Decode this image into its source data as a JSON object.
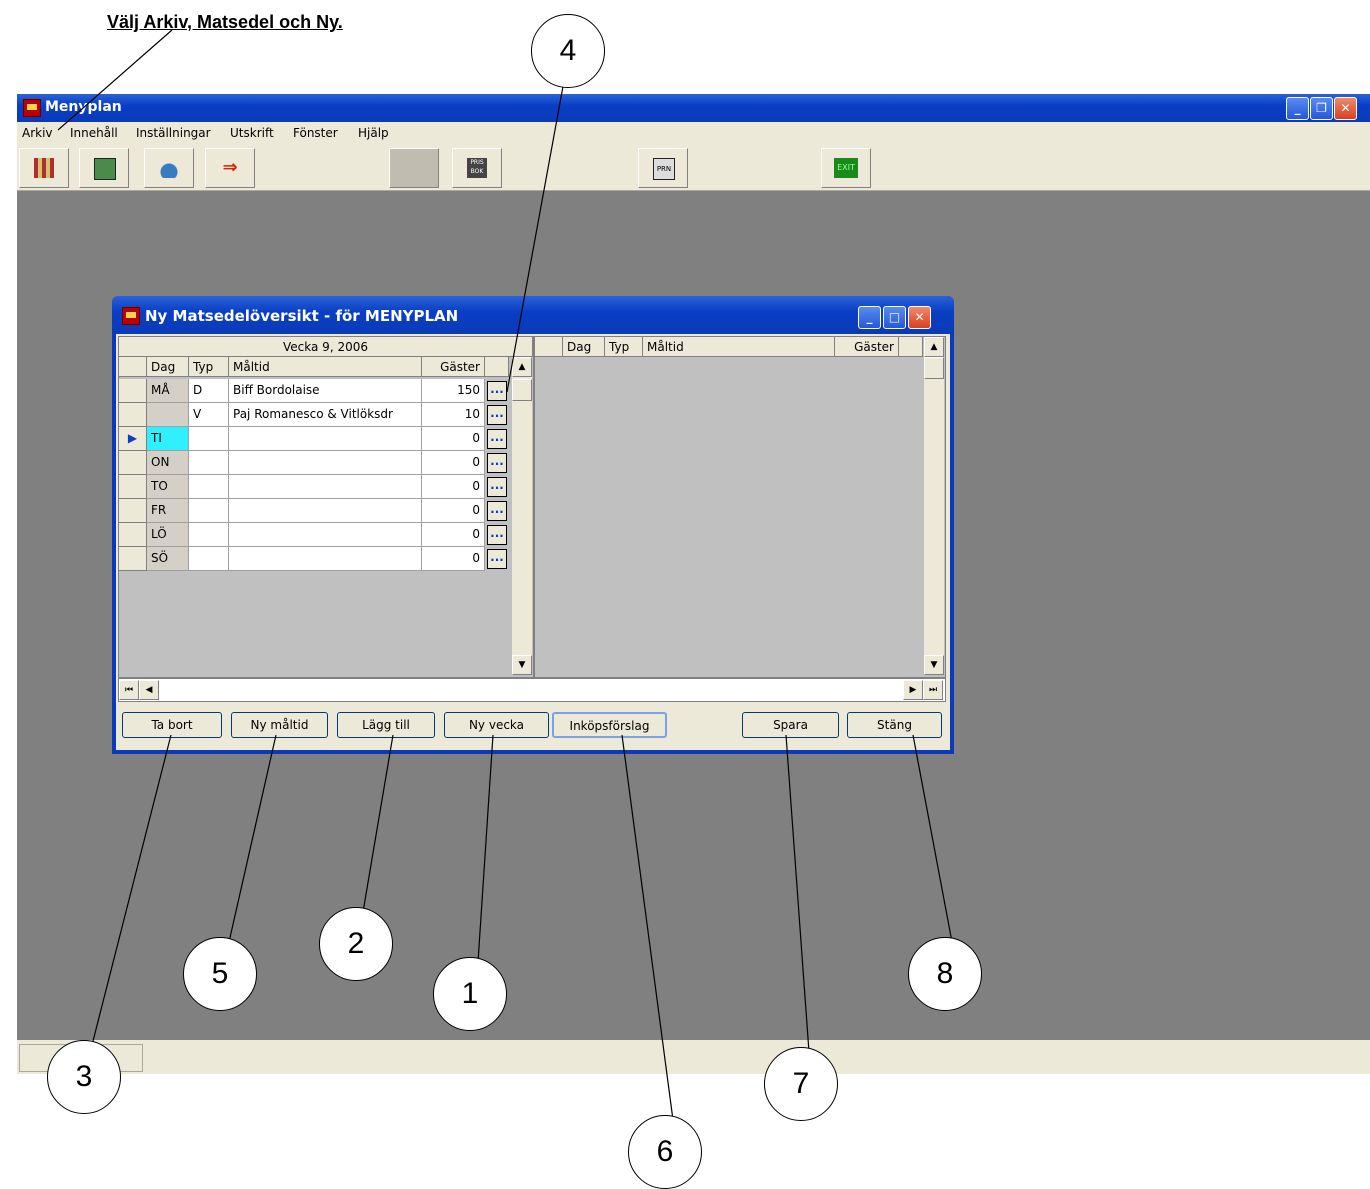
{
  "instruction": "Välj Arkiv, Matsedel och Ny.",
  "app": {
    "title": "Menyplan",
    "menu": [
      "Arkiv",
      "Innehåll",
      "Inställningar",
      "Utskrift",
      "Fönster",
      "Hjälp"
    ],
    "toolbar_icons": [
      "menu-grid-icon",
      "exit-door-icon",
      "cooking-pot-icon",
      "arrow-exit-icon",
      "blank-icon",
      "prisbok-icon",
      "printer-icon",
      "exit-sign-icon"
    ],
    "toolbar_labels": {
      "prisbok": "PRIS BOK",
      "printer": "PRN",
      "exit": "EXIT"
    }
  },
  "child_window": {
    "title": "Ny Matsedelöversikt - för MENYPLAN",
    "week_label": "Vecka 9, 2006",
    "columns": [
      "Dag",
      "Typ",
      "Måltid",
      "Gäster"
    ],
    "rows": [
      {
        "dag": "MÅ",
        "typ": "D",
        "maltid": "Biff Bordolaise",
        "gaster": "150"
      },
      {
        "dag": "",
        "typ": "V",
        "maltid": "Paj Romanesco & Vitlöksdr",
        "gaster": "10"
      },
      {
        "dag": "TI",
        "typ": "",
        "maltid": "",
        "gaster": "0"
      },
      {
        "dag": "ON",
        "typ": "",
        "maltid": "",
        "gaster": "0"
      },
      {
        "dag": "TO",
        "typ": "",
        "maltid": "",
        "gaster": "0"
      },
      {
        "dag": "FR",
        "typ": "",
        "maltid": "",
        "gaster": "0"
      },
      {
        "dag": "LÖ",
        "typ": "",
        "maltid": "",
        "gaster": "0"
      },
      {
        "dag": "SÖ",
        "typ": "",
        "maltid": "",
        "gaster": "0"
      }
    ],
    "dots_label": "...",
    "buttons": {
      "ta_bort": "Ta bort",
      "ny_maltid": "Ny måltid",
      "lagg_till": "Lägg till",
      "ny_vecka": "Ny vecka",
      "inkopsforslag": "Inköpsförslag",
      "spara": "Spara",
      "stang": "Stäng"
    }
  },
  "callouts": [
    "1",
    "2",
    "3",
    "4",
    "5",
    "6",
    "7",
    "8"
  ]
}
